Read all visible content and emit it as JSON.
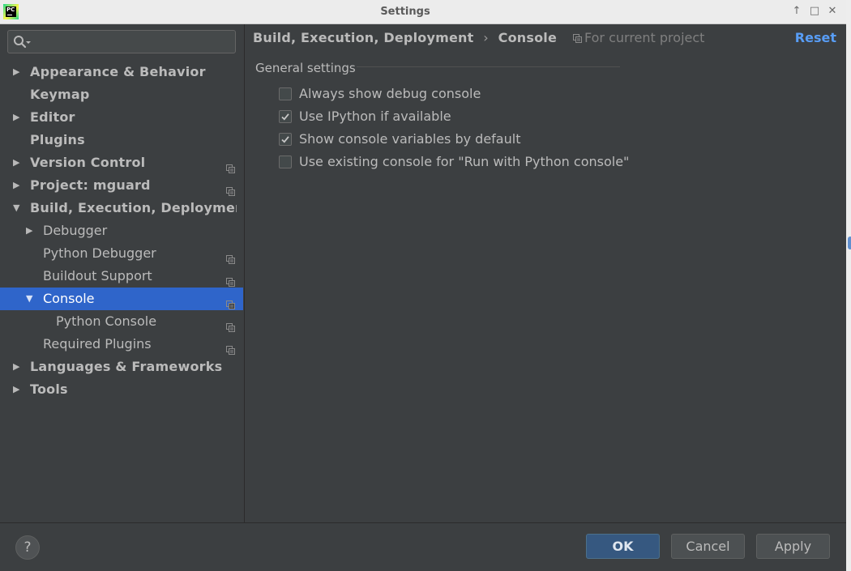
{
  "window": {
    "title": "Settings",
    "app_icon": "pycharm-app-icon",
    "app_icon_text": "PC",
    "controls": {
      "pin": "↑",
      "maximize": "□",
      "close": "✕"
    }
  },
  "search": {
    "value": "",
    "placeholder": ""
  },
  "tree": [
    {
      "label": "Appearance & Behavior",
      "level": 0,
      "arrow": "right",
      "project": false,
      "selected": false
    },
    {
      "label": "Keymap",
      "level": 0,
      "arrow": "none",
      "project": false,
      "selected": false
    },
    {
      "label": "Editor",
      "level": 0,
      "arrow": "right",
      "project": false,
      "selected": false
    },
    {
      "label": "Plugins",
      "level": 0,
      "arrow": "none",
      "project": false,
      "selected": false
    },
    {
      "label": "Version Control",
      "level": 0,
      "arrow": "right",
      "project": true,
      "selected": false
    },
    {
      "label": "Project: mguard",
      "level": 0,
      "arrow": "right",
      "project": true,
      "selected": false
    },
    {
      "label": "Build, Execution, Deployment",
      "level": 0,
      "arrow": "down",
      "project": false,
      "selected": false
    },
    {
      "label": "Debugger",
      "level": 1,
      "arrow": "right",
      "project": false,
      "selected": false
    },
    {
      "label": "Python Debugger",
      "level": 1,
      "arrow": "none",
      "project": true,
      "selected": false
    },
    {
      "label": "Buildout Support",
      "level": 1,
      "arrow": "none",
      "project": true,
      "selected": false
    },
    {
      "label": "Console",
      "level": 1,
      "arrow": "down",
      "project": true,
      "selected": true
    },
    {
      "label": "Python Console",
      "level": 2,
      "arrow": "none",
      "project": true,
      "selected": false
    },
    {
      "label": "Required Plugins",
      "level": 1,
      "arrow": "none",
      "project": true,
      "selected": false
    },
    {
      "label": "Languages & Frameworks",
      "level": 0,
      "arrow": "right",
      "project": false,
      "selected": false
    },
    {
      "label": "Tools",
      "level": 0,
      "arrow": "right",
      "project": false,
      "selected": false
    }
  ],
  "content": {
    "breadcrumb": {
      "parent": "Build, Execution, Deployment",
      "separator": "›",
      "current": "Console"
    },
    "scope_note": "For current project",
    "reset_label": "Reset",
    "group_title": "General settings",
    "options": [
      {
        "label": "Always show debug console",
        "checked": false
      },
      {
        "label": "Use IPython if available",
        "checked": true
      },
      {
        "label": "Show console variables by default",
        "checked": true
      },
      {
        "label": "Use existing console for \"Run with Python console\"",
        "checked": false
      }
    ]
  },
  "footer": {
    "help_label": "?",
    "ok_label": "OK",
    "cancel_label": "Cancel",
    "apply_label": "Apply"
  },
  "colors": {
    "background": "#3c3f41",
    "selection": "#2f65ca",
    "link": "#589df6",
    "primary_button": "#365880"
  }
}
